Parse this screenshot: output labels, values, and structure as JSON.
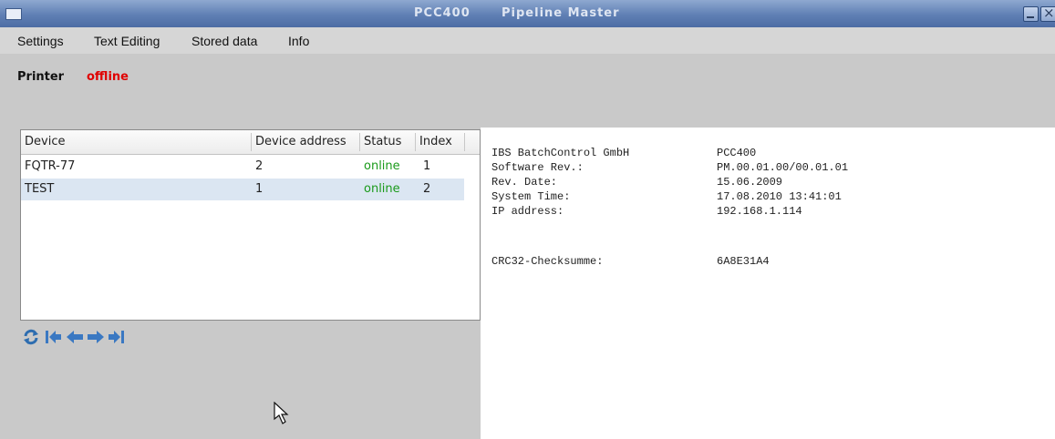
{
  "window": {
    "app_name": "PCC400",
    "title": "Pipeline Master"
  },
  "menu": [
    "Settings",
    "Text Editing",
    "Stored data",
    "Info"
  ],
  "printer": {
    "label": "Printer",
    "status": "offline",
    "status_color": "#e00000"
  },
  "device_table": {
    "columns": [
      "Device",
      "Device address",
      "Status",
      "Index"
    ],
    "rows": [
      {
        "device": "FQTR-77",
        "address": "2",
        "status": "online",
        "index": "1",
        "selected": false
      },
      {
        "device": "TEST",
        "address": "1",
        "status": "online",
        "index": "2",
        "selected": true
      }
    ],
    "status_color": "#1a9a1a",
    "selected_color": "#dbe6f2"
  },
  "navigation": [
    "refresh-icon",
    "first-icon",
    "previous-icon",
    "next-icon",
    "last-icon"
  ],
  "info": [
    {
      "label": "IBS BatchControl GmbH",
      "value": "PCC400"
    },
    {
      "label": "Software Rev.:",
      "value": "PM.00.01.00/00.01.01"
    },
    {
      "label": "Rev. Date:",
      "value": "15.06.2009"
    },
    {
      "label": "System Time:",
      "value": "17.08.2010 13:41:01"
    },
    {
      "label": "IP address:",
      "value": "192.168.1.114"
    },
    {
      "label": "CRC32-Checksumme:",
      "value": "6A8E31A4"
    }
  ]
}
